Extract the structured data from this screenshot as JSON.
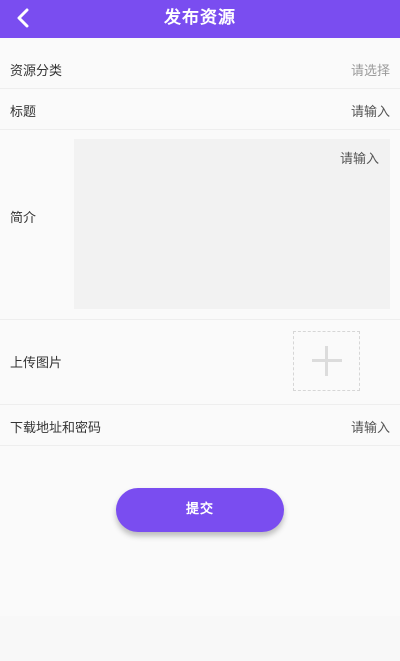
{
  "colors": {
    "accent": "#7a4df0",
    "background": "#fafafa"
  },
  "header": {
    "title": "发布资源",
    "back_icon": "chevron-left-icon"
  },
  "form": {
    "category": {
      "label": "资源分类",
      "placeholder": "请选择"
    },
    "title": {
      "label": "标题",
      "placeholder": "请输入"
    },
    "intro": {
      "label": "简介",
      "placeholder": "请输入"
    },
    "image": {
      "label": "上传图片",
      "upload_icon": "plus-icon"
    },
    "download": {
      "label": "下载地址和密码",
      "placeholder": "请输入"
    }
  },
  "submit": {
    "label": "提交"
  }
}
